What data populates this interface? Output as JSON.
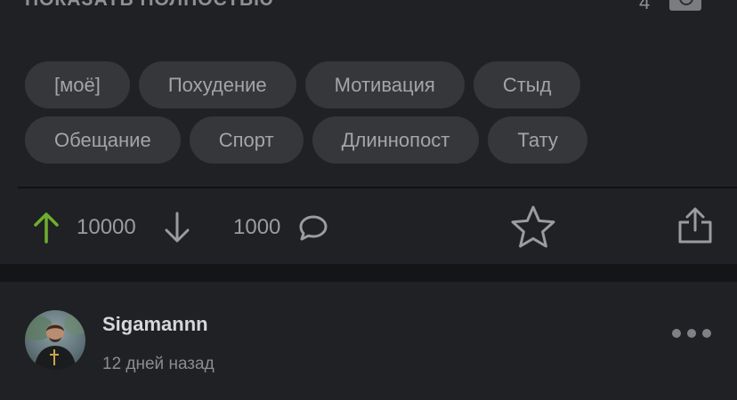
{
  "post": {
    "show_more_label": "ПОКАЗАТЬ ПОЛНОСТЬЮ",
    "image_count": "4",
    "tags_row1": [
      "[моё]",
      "Похудение",
      "Мотивация",
      "Стыд"
    ],
    "tags_row2": [
      "Обещание",
      "Спорт",
      "Длиннопост",
      "Тату"
    ],
    "rating": "10000",
    "comments_count": "1000"
  },
  "next_post": {
    "author": "Sigamannn",
    "time": "12 дней назад"
  },
  "colors": {
    "background": "#1f2124",
    "tag_background": "#35373b",
    "upvote_green": "#6fae2f",
    "icon_gray": "#9a9ca0"
  },
  "icons": [
    "image-icon",
    "up-arrow-icon",
    "down-arrow-icon",
    "comment-icon",
    "star-icon",
    "share-icon",
    "more-icon"
  ]
}
